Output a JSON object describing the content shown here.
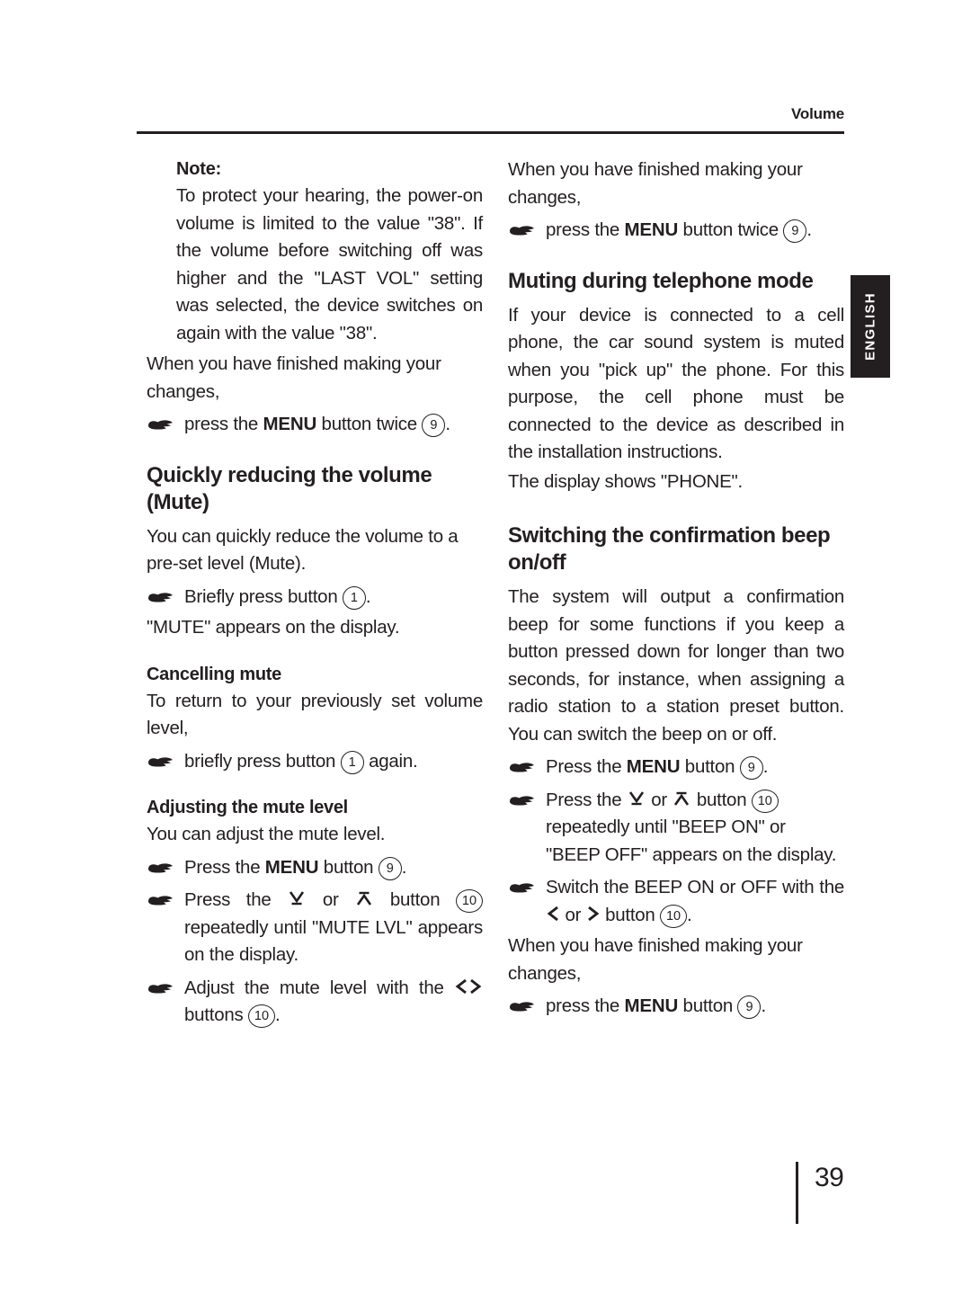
{
  "header": {
    "title": "Volume"
  },
  "side_tab": {
    "label": "ENGLISH"
  },
  "footer": {
    "page_number": "39"
  },
  "icons": {
    "bullet": "pointing-hand-icon",
    "key_down": "down-arrow-key-icon",
    "key_up": "up-arrow-key-icon",
    "key_left": "left-chevron-key-icon",
    "key_right": "right-chevron-key-icon"
  },
  "left_column": {
    "note": {
      "title": "Note:",
      "text": "To protect your hearing, the power-on volume is limited to the value \"38\". If the volume before switching off was higher and the \"LAST VOL\" setting was selected, the device switches on again with the value \"38\"."
    },
    "finished_text": "When you have finished making your changes,",
    "finished_bullet": {
      "before": "press the ",
      "keyword": "MENU",
      "after": " button twice ",
      "ref": "9",
      "end": "."
    },
    "section_mute": {
      "heading": "Quickly reducing the volume (Mute)",
      "intro": "You can quickly reduce the volume to a pre-set level (Mute).",
      "bullet": {
        "before": "Briefly press button ",
        "ref": "1",
        "end": "."
      },
      "after": "\"MUTE\" appears on the display."
    },
    "section_cancel": {
      "heading": "Cancelling mute",
      "intro": "To return to your previously set volume level,",
      "bullet": {
        "before": "briefly press button ",
        "ref": "1",
        "after": " again."
      }
    },
    "section_adjust": {
      "heading": "Adjusting the mute level",
      "intro": "You can adjust the mute level.",
      "bullet_menu": {
        "before": "Press the ",
        "keyword": "MENU",
        "after": " button ",
        "ref": "9",
        "end": "."
      },
      "bullet_arrows": {
        "before": "Press the ",
        "middle": " or ",
        "after": " button ",
        "ref": "10",
        "end": " repeatedly until \"MUTE LVL\" appears on the display."
      },
      "bullet_adjust": {
        "before": "Adjust the mute level with the ",
        "after": " buttons ",
        "ref": "10",
        "end": "."
      }
    }
  },
  "right_column": {
    "finished_text": "When you have finished making your changes,",
    "finished_bullet": {
      "before": "press the ",
      "keyword": "MENU",
      "after": " button twice ",
      "ref": "9",
      "end": "."
    },
    "section_phone": {
      "heading": "Muting during telephone mode",
      "text": "If your device is connected to a cell phone, the car sound system is muted when you \"pick up\" the phone. For this purpose, the cell phone must be connected to the device as described in the installation instructions.",
      "display": "The display shows \"PHONE\"."
    },
    "section_beep": {
      "heading": "Switching the confirmation beep on/off",
      "text": "The system will output a confirmation beep for some functions if you keep a button pressed down for longer than two seconds, for instance, when assigning a radio station to a station preset button. You can switch the beep on or off.",
      "bullet_menu": {
        "before": "Press the ",
        "keyword": "MENU",
        "after": " button ",
        "ref": "9",
        "end": "."
      },
      "bullet_arrows": {
        "before": "Press the ",
        "middle": " or ",
        "after": " button ",
        "ref": "10",
        "end": " repeatedly until \"BEEP ON\" or \"BEEP OFF\" appears on the display."
      },
      "bullet_switch": {
        "before": "Switch the BEEP ON or OFF with the ",
        "middle": " or ",
        "after": " button ",
        "ref": "10",
        "end": "."
      },
      "finished_text": "When you have finished making your changes,",
      "finished_bullet": {
        "before": "press the ",
        "keyword": "MENU",
        "after": " button ",
        "ref": "9",
        "end": "."
      }
    }
  }
}
